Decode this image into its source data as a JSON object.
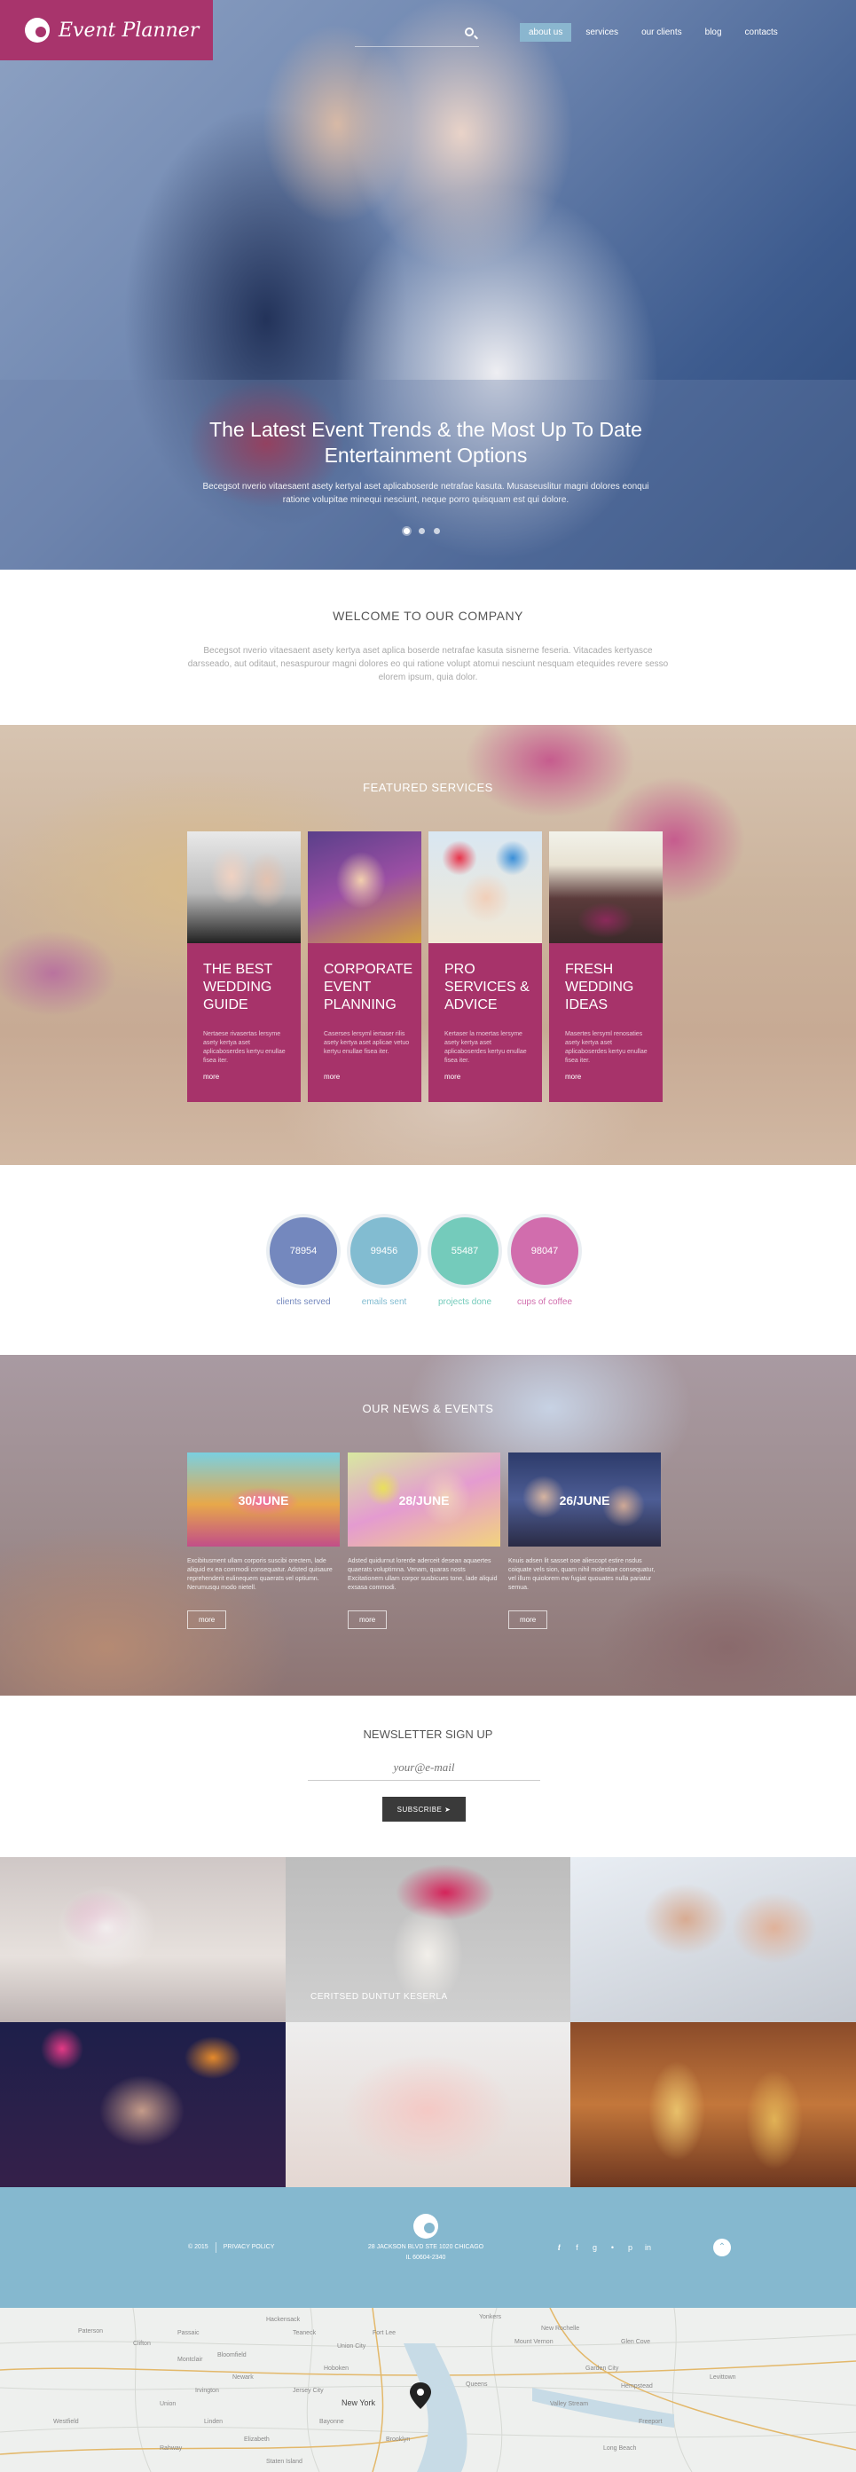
{
  "brand": {
    "name": "Event Planner"
  },
  "nav": {
    "items": [
      "about us",
      "services",
      "our clients",
      "blog",
      "contacts"
    ],
    "active": "about us"
  },
  "hero": {
    "title": "The Latest Event Trends & the Most Up To Date Entertainment Options",
    "text": "Becegsot nverio vitaesaent asety kertyal aset aplicaboserde netrafae kasuta. Musaseuslitur magni dolores eonqui ratione volupitae minequi nesciunt, neque porro quisquam est qui dolore.",
    "slides": 3
  },
  "welcome": {
    "title": "WELCOME TO OUR COMPANY",
    "text": "Becegsot nverio vitaesaent asety kertya aset aplica boserde netrafae kasuta sisnerne feseria. Vitacades kertyasce darsseado, aut oditaut, nesaspurour magni dolores eo qui ratione volupt atomui nesciunt nesquam etequides revere sesso elorem ipsum, quia dolor."
  },
  "featured": {
    "title": "FEATURED SERVICES",
    "cards": [
      {
        "title": "THE BEST WEDDING GUIDE",
        "text": "Nertaese rivasertas lersyme asety kertya aset aplicaboserdes kertyu enullae fisea iter.",
        "link": "more"
      },
      {
        "title": "CORPORATE EVENT PLANNING",
        "text": "Caserses lersyml iertaser rilis asety kertya aset aplicae vetuo kertyu enullae fisea iter.",
        "link": "more"
      },
      {
        "title": "PRO SERVICES & ADVICE",
        "text": "Kertaser la rnoertas lersyme asety kertya aset aplicaboserdes kertyu enullae fisea iter.",
        "link": "more"
      },
      {
        "title": "FRESH WEDDING IDEAS",
        "text": "Masertes lersyml renosaties asety kertya aset aplicaboserdes kertyu enullae fisea iter.",
        "link": "more"
      }
    ]
  },
  "stats": [
    {
      "value": "78954",
      "label": "clients served",
      "color": "#7488be"
    },
    {
      "value": "99456",
      "label": "emails sent",
      "color": "#82bcd1"
    },
    {
      "value": "55487",
      "label": "projects done",
      "color": "#74cbbb"
    },
    {
      "value": "98047",
      "label": "cups of coffee",
      "color": "#d16dad"
    }
  ],
  "news": {
    "title": "OUR NEWS & EVENTS",
    "items": [
      {
        "date": "30/JUNE",
        "text": "Excibitusment ullam corporis suscibi orectem, lade aliquid ex ea commodi consequatur. Adsted quisaure reprehenderit eulinequem quaerats vel optiumn. Nerumusqu modo nietell.",
        "link": "more"
      },
      {
        "date": "28/JUNE",
        "text": "Adsted quidurnut lorerde aderceit desean aquaertes quaerats voluptimna. Venam, quaras nosts Excitationem ullam corpor susbicues tone, lade aliquid exsasa commodi.",
        "link": "more"
      },
      {
        "date": "26/JUNE",
        "text": "Knuis adsen lit sasset ooe aliescopt estire nsdus coiquate vels sion, quam nihil molestiae consequatur, vel illum quiolorem ew fugiat quouates nulla pariatur semua.",
        "link": "more"
      }
    ]
  },
  "newsletter": {
    "title": "NEWSLETTER SIGN UP",
    "placeholder": "your@e-mail",
    "button": "SUBSCRIBE"
  },
  "gallery": {
    "caption": "CERITSED DUNTUT KESERLA"
  },
  "footer": {
    "year": "© 2015",
    "privacy": "PRIVACY POLICY",
    "address": "28 JACKSON BLVD STE 1020 CHICAGO",
    "address2": "IL 60604-2340",
    "social": [
      "twitter-icon",
      "facebook-icon",
      "google-plus-icon",
      "rss-icon",
      "pinterest-icon",
      "linkedin-icon"
    ]
  },
  "map": {
    "labels": [
      "Paterson",
      "Clifton",
      "Passaic",
      "Newark",
      "Elizabeth",
      "Jersey City",
      "Hoboken",
      "New York",
      "Queens",
      "Brooklyn",
      "Union City",
      "Yonkers",
      "Hempstead",
      "Garden City",
      "Glen Cove",
      "Freeport",
      "Staten Island",
      "Linden",
      "Valley Stream",
      "Fort Lee",
      "Hackensack",
      "Teaneck",
      "New Rochelle",
      "Mount Vernon",
      "Bayonne",
      "Levittown",
      "Long Beach",
      "Westfield",
      "Rahway",
      "Union",
      "Irvington",
      "Bloomfield",
      "Montclair"
    ]
  }
}
